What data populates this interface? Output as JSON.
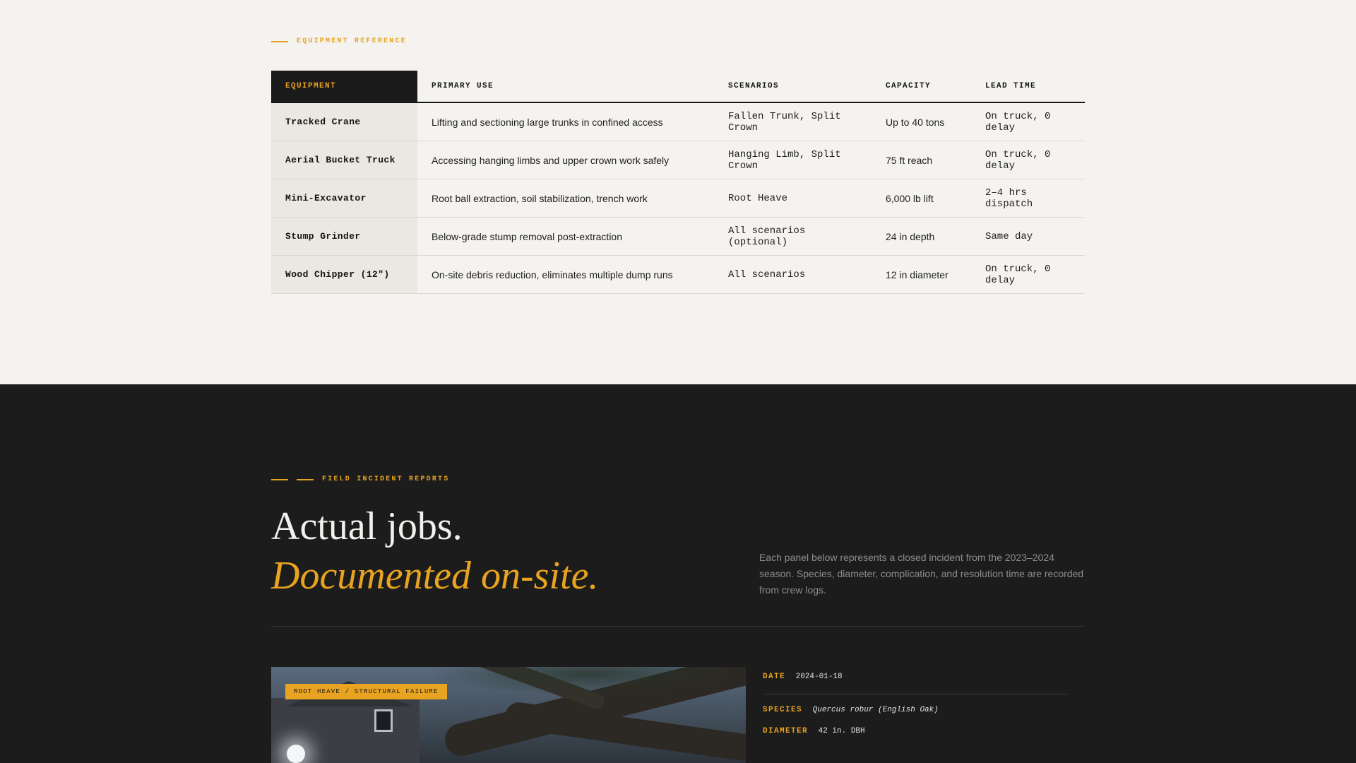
{
  "equipment": {
    "eyebrow": "EQUIPMENT REFERENCE",
    "columns": [
      "EQUIPMENT",
      "PRIMARY USE",
      "SCENARIOS",
      "CAPACITY",
      "LEAD TIME"
    ],
    "rows": [
      {
        "name": "Tracked Crane",
        "use": "Lifting and sectioning large trunks in confined access",
        "scenarios": "Fallen Trunk, Split Crown",
        "capacity": "Up to 40 tons",
        "lead": "On truck, 0 delay",
        "lead_status": "green"
      },
      {
        "name": "Aerial Bucket Truck",
        "use": "Accessing hanging limbs and upper crown work safely",
        "scenarios": "Hanging Limb, Split Crown",
        "capacity": "75 ft reach",
        "lead": "On truck, 0 delay",
        "lead_status": "green"
      },
      {
        "name": "Mini-Excavator",
        "use": "Root ball extraction, soil stabilization, trench work",
        "scenarios": "Root Heave",
        "capacity": "6,000 lb lift",
        "lead": "2–4 hrs dispatch",
        "lead_status": "gray"
      },
      {
        "name": "Stump Grinder",
        "use": "Below-grade stump removal post-extraction",
        "scenarios": "All scenarios (optional)",
        "capacity": "24 in depth",
        "lead": "Same day",
        "lead_status": "gray"
      },
      {
        "name": "Wood Chipper (12\")",
        "use": "On-site debris reduction, eliminates multiple dump runs",
        "scenarios": "All scenarios",
        "capacity": "12 in diameter",
        "lead": "On truck, 0 delay",
        "lead_status": "green"
      }
    ]
  },
  "reports": {
    "eyebrow": "FIELD INCIDENT REPORTS",
    "headline_line1": "Actual jobs.",
    "headline_line2": "Documented on-site.",
    "lede": "Each panel below represents a closed incident from the 2023–2024 season. Species, diameter, complication, and resolution time are recorded from crew logs.",
    "incident": {
      "tag": "ROOT HEAVE / STRUCTURAL FAILURE",
      "date_label": "DATE",
      "date": "2024-01-18",
      "species_label": "SPECIES",
      "species": "Quercus robur (English Oak)",
      "diameter_label": "DIAMETER",
      "diameter": "42 in. DBH"
    }
  },
  "colors": {
    "accent": "#e8a320",
    "dark_bg": "#1c1c1c",
    "light_bg": "#f5f3ef",
    "status_green": "#2f8a4a"
  }
}
